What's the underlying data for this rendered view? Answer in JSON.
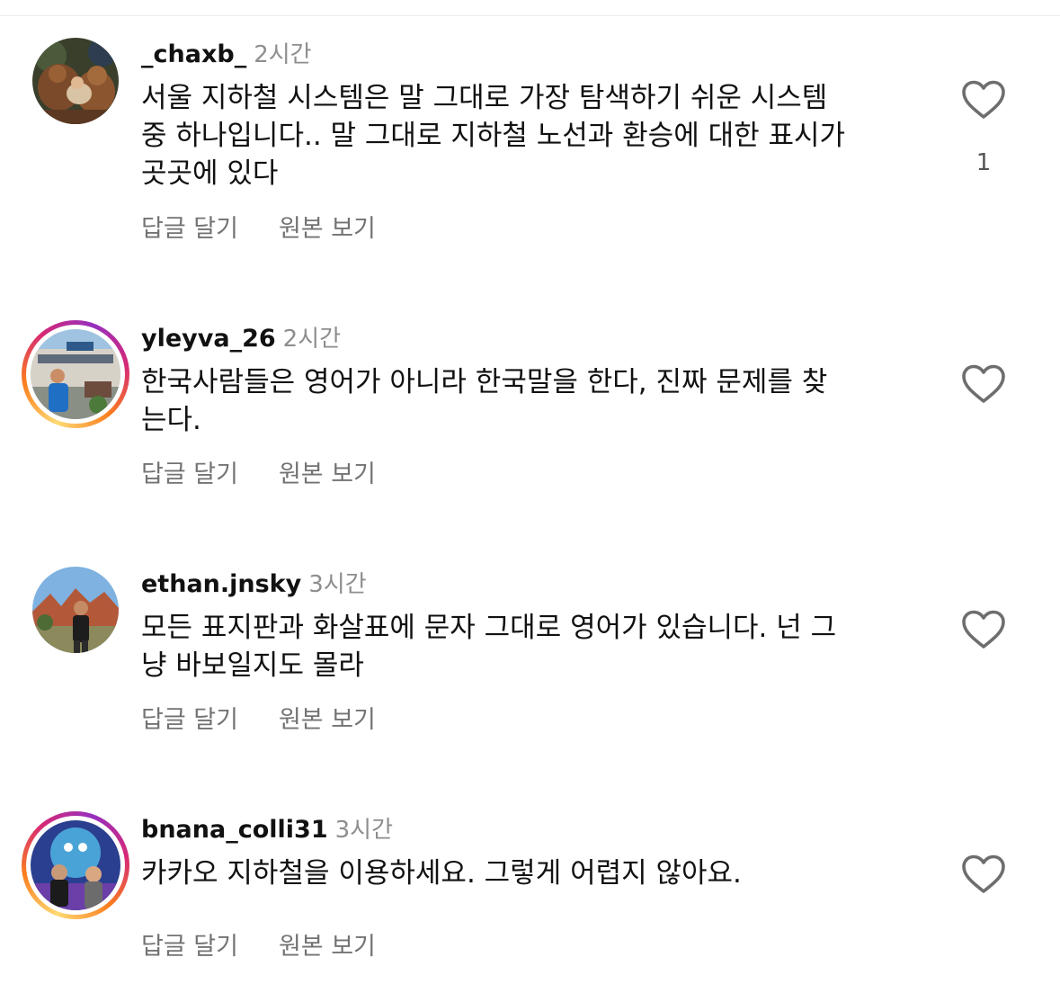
{
  "comments": [
    {
      "username": "_chaxb_",
      "time": "2시간",
      "text": "서울 지하철 시스템은 말 그대로 가장 탐색하기 쉬운 시스템\n중 하나입니다.. 말 그대로 지하철 노선과 환승에 대한 표시가\n곳곳에 있다",
      "reply_label": "답글 달기",
      "translate_label": "원본 보기",
      "like_count": "1",
      "has_story_ring": false
    },
    {
      "username": "yleyva_26",
      "time": "2시간",
      "text": "한국사람들은 영어가 아니라 한국말을 한다, 진짜 문제를 찾\n는다.",
      "reply_label": "답글 달기",
      "translate_label": "원본 보기",
      "like_count": "",
      "has_story_ring": true
    },
    {
      "username": "ethan.jnsky",
      "time": "3시간",
      "text": "모든 표지판과 화살표에 문자 그대로 영어가 있습니다. 넌 그\n냥 바보일지도 몰라",
      "reply_label": "답글 달기",
      "translate_label": "원본 보기",
      "like_count": "",
      "has_story_ring": false
    },
    {
      "username": "bnana_colli31",
      "time": "3시간",
      "text": "카카오 지하철을 이용하세요. 그렇게 어렵지 않아요.",
      "reply_label": "답글 달기",
      "translate_label": "원본 보기",
      "like_count": "",
      "has_story_ring": true
    }
  ],
  "icons": {
    "like": "heart-outline-icon",
    "avatar": "user-photo"
  },
  "colors": {
    "username": "#111111",
    "timestamp": "#8e8e8e",
    "action_text": "#737373",
    "heart_stroke": "#6e6e6e",
    "story_ring": [
      "#feda75",
      "#fa7e1e",
      "#d62976",
      "#962fbf"
    ]
  }
}
